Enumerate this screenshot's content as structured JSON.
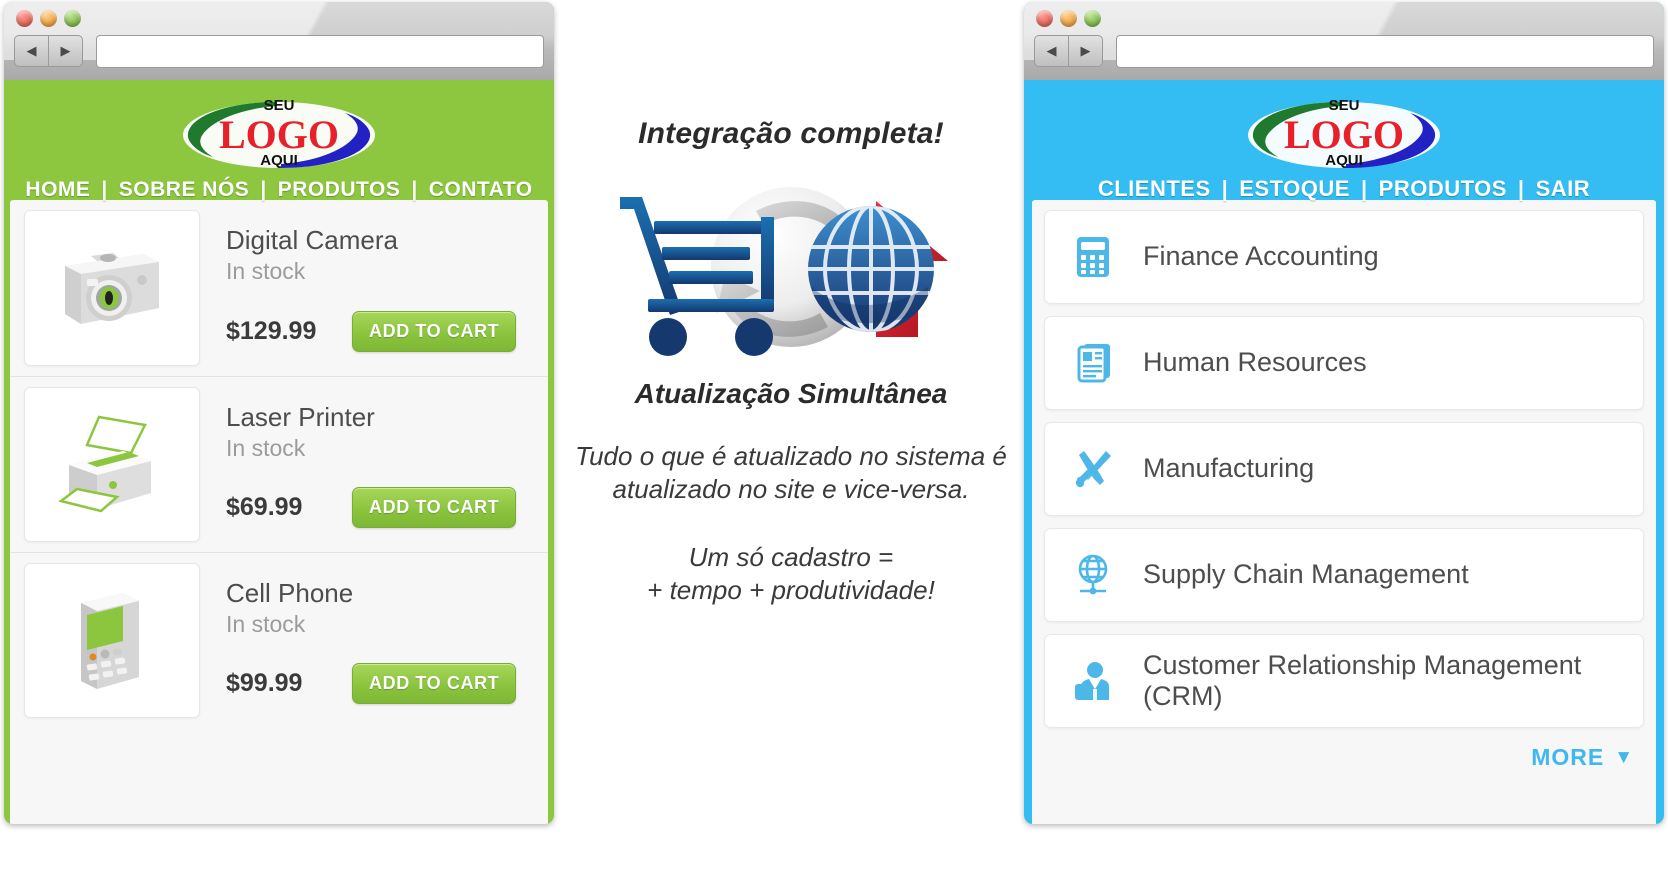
{
  "left_window": {
    "name": "storefront-browser",
    "traffic_lights": [
      "close",
      "minimize",
      "zoom"
    ],
    "nav_back_icon": "back-arrow-icon",
    "nav_forward_icon": "forward-arrow-icon",
    "address_value": "",
    "address_placeholder": "",
    "logo": {
      "top": "SEU",
      "main": "LOGO",
      "bottom": "AQUI"
    },
    "accent_color": "#8dc63f",
    "nav_links": [
      "HOME",
      "SOBRE NÓS",
      "PRODUTOS",
      "CONTATO"
    ],
    "nav_separator": "|",
    "products": [
      {
        "name": "Digital Camera",
        "stock": "In stock",
        "price": "$129.99",
        "button": "ADD TO CART",
        "icon": "digital-camera-icon"
      },
      {
        "name": "Laser Printer",
        "stock": "In stock",
        "price": "$69.99",
        "button": "ADD TO CART",
        "icon": "laser-printer-icon"
      },
      {
        "name": "Cell Phone",
        "stock": "In stock",
        "price": "$99.99",
        "button": "ADD TO CART",
        "icon": "cell-phone-icon"
      }
    ]
  },
  "center": {
    "title": "Integração completa!",
    "figure_icon": "cart-sync-globe-icon",
    "subtitle": "Atualização Simultânea",
    "paragraph_1": "Tudo o que é atualizado no sistema é atualizado no site e vice-versa.",
    "paragraph_2_line_1": "Um só cadastro =",
    "paragraph_2_line_2": "+ tempo + produtividade!"
  },
  "right_window": {
    "name": "erp-browser",
    "traffic_lights": [
      "close",
      "minimize",
      "zoom"
    ],
    "nav_back_icon": "back-arrow-icon",
    "nav_forward_icon": "forward-arrow-icon",
    "address_value": "",
    "address_placeholder": "",
    "logo": {
      "top": "SEU",
      "main": "LOGO",
      "bottom": "AQUI"
    },
    "accent_color": "#33bdf2",
    "nav_links": [
      "CLIENTES",
      "ESTOQUE",
      "PRODUTOS",
      "SAIR"
    ],
    "nav_separator": "|",
    "modules": [
      {
        "label": "Finance Accounting",
        "icon": "calculator-icon"
      },
      {
        "label": "Human Resources",
        "icon": "documents-icon"
      },
      {
        "label": "Manufacturing",
        "icon": "wrench-screwdriver-icon"
      },
      {
        "label": "Supply Chain Management",
        "icon": "globe-network-icon"
      },
      {
        "label": "Customer Relationship Management (CRM)",
        "icon": "businessperson-icon"
      }
    ],
    "more_label": "MORE",
    "more_caret": "▼"
  }
}
